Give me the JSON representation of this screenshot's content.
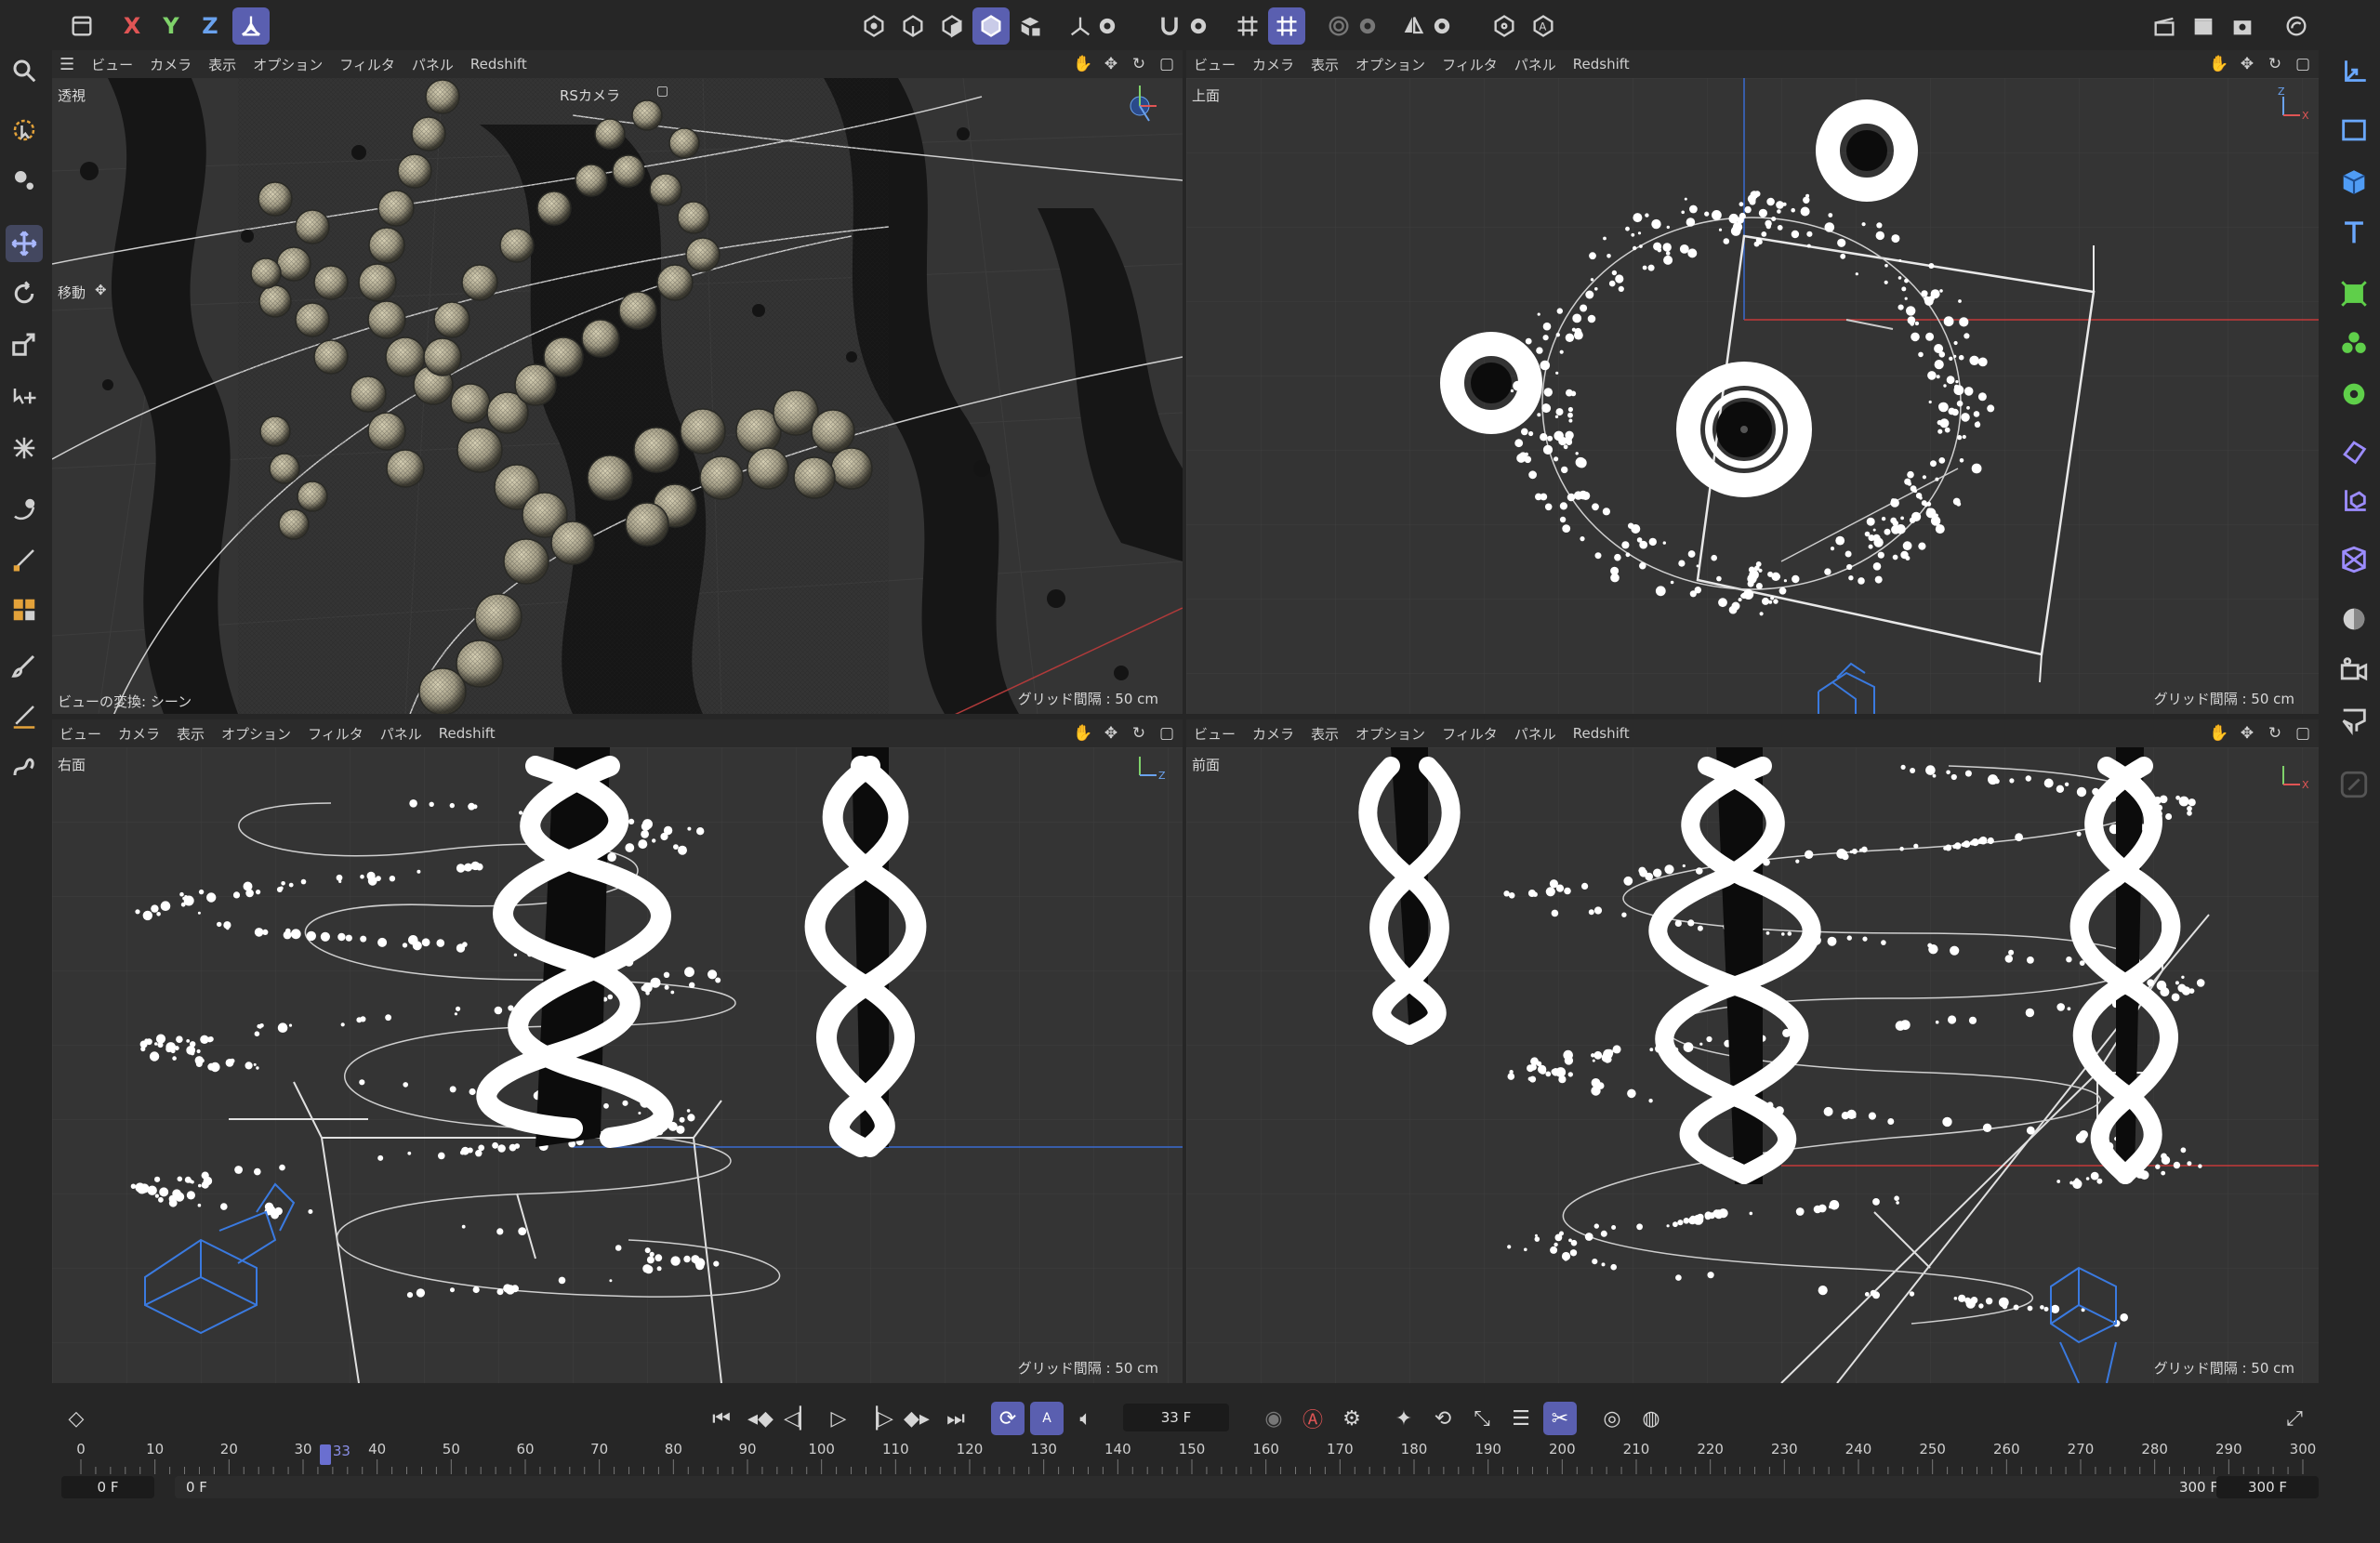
{
  "top_toolbar": {
    "axis_x": "X",
    "axis_y": "Y",
    "axis_z": "Z"
  },
  "viewports": [
    {
      "id": "perspective",
      "menu": [
        "ビュー",
        "カメラ",
        "表示",
        "オプション",
        "フィルタ",
        "パネル",
        "Redshift"
      ],
      "name": "透視",
      "camera": "RSカメラ",
      "mode": "移動",
      "transform": "ビューの変換: シーン",
      "grid": "グリッド間隔 : 50 cm"
    },
    {
      "id": "top",
      "menu": [
        "ビュー",
        "カメラ",
        "表示",
        "オプション",
        "フィルタ",
        "パネル",
        "Redshift"
      ],
      "name": "上面",
      "grid": "グリッド間隔 : 50 cm"
    },
    {
      "id": "right",
      "menu": [
        "ビュー",
        "カメラ",
        "表示",
        "オプション",
        "フィルタ",
        "パネル",
        "Redshift"
      ],
      "name": "右面",
      "grid": "グリッド間隔 : 50 cm"
    },
    {
      "id": "front",
      "menu": [
        "ビュー",
        "カメラ",
        "表示",
        "オプション",
        "フィルタ",
        "パネル",
        "Redshift"
      ],
      "name": "前面",
      "grid": "グリッド間隔 : 50 cm"
    }
  ],
  "timeline": {
    "current_frame": "33 F",
    "current_frame_value": 33,
    "ruler_ticks": [
      "0",
      "10",
      "20",
      "30",
      "40",
      "50",
      "60",
      "70",
      "80",
      "90",
      "100",
      "110",
      "120",
      "130",
      "140",
      "150",
      "160",
      "170",
      "180",
      "190",
      "200",
      "210",
      "220",
      "230",
      "240",
      "250",
      "260",
      "270",
      "280",
      "290",
      "300"
    ],
    "playhead_label": "33",
    "range_start": "0 F",
    "preview_start": "0 F",
    "preview_end": "300 F",
    "range_end": "300 F"
  },
  "colors": {
    "accent": "#5a5fb0",
    "axis_x": "#e05555",
    "axis_y": "#7fd26a",
    "axis_z": "#6aa2ee",
    "viewport_bg": "#343434",
    "ui_bg": "#262626"
  },
  "icons": {
    "top_toolbar": [
      "panel-icon",
      "axis-lock-icon",
      "point-mode-icon",
      "edge-mode-icon",
      "poly-mode-icon",
      "object-mode-icon",
      "texture-mode-icon",
      "axis-icon",
      "settings-icon",
      "magnet-icon",
      "settings-icon",
      "grid-snap-icon",
      "snap-settings-icon",
      "workplane-icon",
      "symmetry-icon",
      "render-region-icon",
      "render-auto-icon",
      "clapper-icon",
      "render-view-icon",
      "render-settings-icon",
      "redshift-icon"
    ],
    "left_toolbar": [
      "search-icon",
      "select-live-icon",
      "select-settings-icon",
      "move-icon",
      "rotate-icon",
      "scale-icon",
      "transform-move-icon",
      "transform-scale-icon",
      "magnet-brush-icon",
      "knife-icon",
      "extrude-icon",
      "paint-brush-icon",
      "smooth-brush-icon",
      "spline-icon"
    ],
    "right_toolbar": [
      "coordinates-icon",
      "rectangle-icon",
      "cube-icon",
      "text-icon",
      "cloner-icon",
      "mograph-icon",
      "gear-icon",
      "deformer-icon",
      "null-icon",
      "fracture-icon",
      "sky-icon",
      "camera-icon",
      "light-icon",
      "pen-disabled-icon"
    ]
  }
}
